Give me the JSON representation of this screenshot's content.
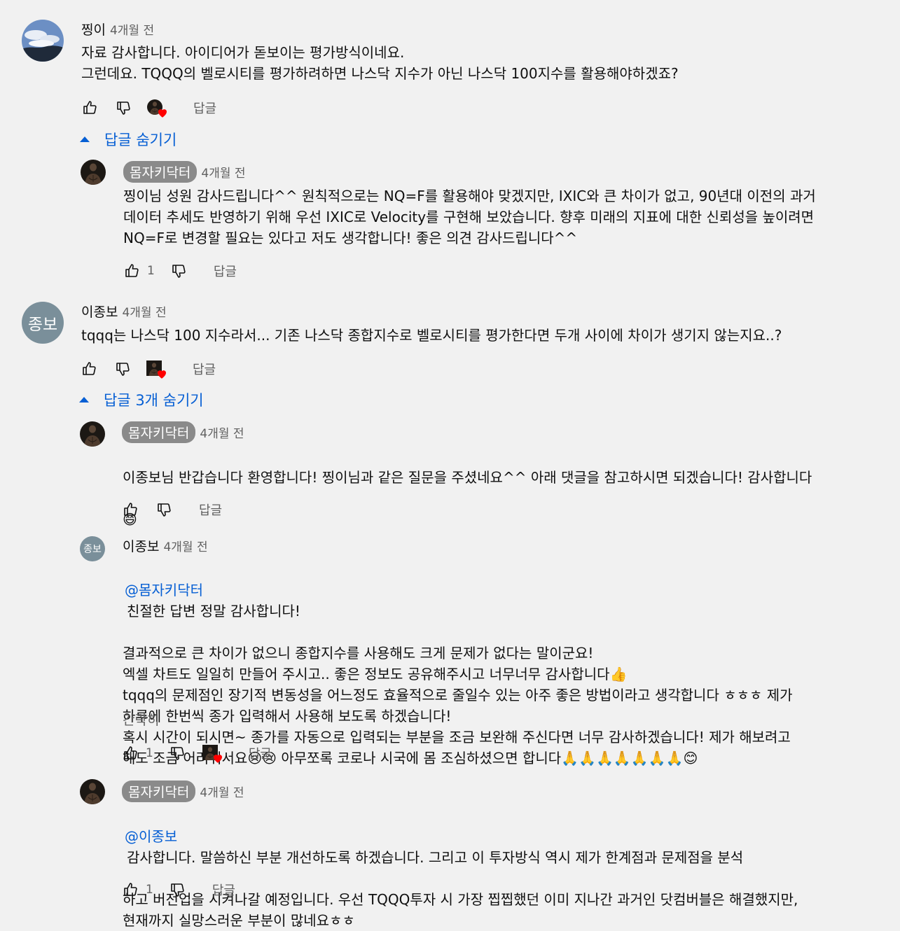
{
  "comments": [
    {
      "author": "찡이",
      "time": "4개월 전",
      "text": "자료 감사합니다. 아이디어가 돋보이는 평가방식이네요.\n그런데요. TQQQ의 벨로시티를 평가하려하면 나스닥 지수가 아닌 나스닥 100지수를 활용해야하겠죠?",
      "reply_label": "답글",
      "toggle_label": "답글 숨기기",
      "replies": [
        {
          "author": "몸자키닥터",
          "time": "4개월 전",
          "text": "찡이님 성원 감사드립니다^^ 원칙적으로는 NQ=F를 활용해야 맞겠지만, IXIC와 큰 차이가 없고, 90년대 이전의 과거\n데이터 추세도 반영하기 위해 우선 IXIC로 Velocity를 구현해 보았습니다. 향후 미래의 지표에 대한 신뢰성을 높이려면\nNQ=F로 변경할 필요는 있다고 저도 생각합니다! 좋은 의견 감사드립니다^^",
          "likes": "1",
          "reply_label": "답글"
        }
      ]
    },
    {
      "author": "이종보",
      "avatar_text": "종보",
      "time": "4개월 전",
      "text": "tqqq는 나스닥 100 지수라서... 기존 나스닥 종합지수로 벨로시티를 평가한다면 두개 사이에 차이가 생기지 않는지요..?",
      "reply_label": "답글",
      "toggle_label": "답글 3개 숨기기",
      "replies": [
        {
          "author": "몸자키닥터",
          "time": "4개월 전",
          "text": "이종보님 반갑습니다 환영합니다! 찡이님과 같은 질문을 주셨네요^^ 아래 댓글을 참고하시면 되겠습니다! 감사합니다",
          "emoji": "😄",
          "reply_label": "답글"
        },
        {
          "author": "이종보",
          "avatar_text": "종보",
          "time": "4개월 전",
          "mention": "@몸자키닥터",
          "text_first": "친절한 답변 정말 감사합니다!",
          "text": "결과적으로 큰 차이가 없으니 종합지수를 사용해도 크게 문제가 없다는 말이군요!\n엑셀 차트도 일일히 만들어 주시고.. 좋은 정보도 공유해주시고 너무너무 감사합니다👍\ntqqq의 문제점인 장기적 변동성을 어느정도 효율적으로 줄일수 있는 아주 좋은 방법이라고 생각합니다 ㅎㅎㅎ 제가\n하루에 한번씩 종가 입력해서 사용해 보도록 하겠습니다!\n혹시 시간이 되시면~ 종가를 자동으로 입력되는 부분을 조금 보완해 주신다면 너무 감사하겠습니다! 제가 해보려고\n해도 조금 어려워서요😢😢 아무쪼록 코로나 시국에 몸 조심하셨으면 합니다🙏🙏🙏🙏🙏🙏🙏😊",
          "show_less": "간략히",
          "likes": "1",
          "reply_label": "답글"
        },
        {
          "author": "몸자키닥터",
          "time": "4개월 전",
          "mention": "@이종보",
          "text_first": "감사합니다. 말씀하신 부분 개선하도록 하겠습니다. 그리고 이 투자방식 역시 제가 한계점과 문제점을 분석",
          "text": "하고 버전업을 시켜나갈 예정입니다. 우선 TQQQ투자 시 가장 찝찝했던 이미 지나간 과거인 닷컴버블은 해결했지만,\n현재까지 실망스러운 부분이 많네요ㅎㅎ",
          "likes": "1",
          "reply_label": "답글"
        }
      ]
    }
  ],
  "colors": {
    "link": "#065fd4",
    "heart": "#ff0000",
    "chip": "#8a8a8a",
    "bg": "#f1f1f1"
  },
  "icons": [
    "thumbs-up-icon",
    "thumbs-down-icon",
    "creator-heart-icon",
    "caret-up-icon"
  ]
}
